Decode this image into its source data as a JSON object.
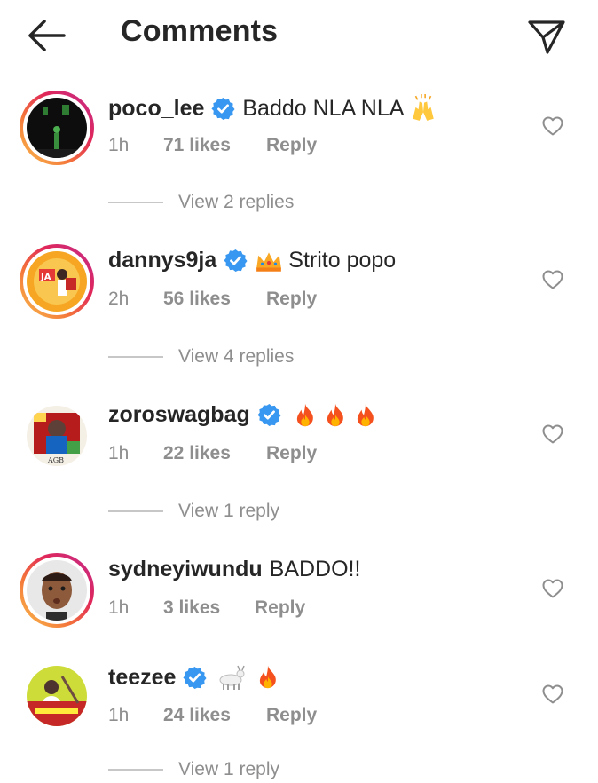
{
  "header": {
    "title": "Comments",
    "back_icon": "arrow-left-icon",
    "share_icon": "send-icon"
  },
  "comments": [
    {
      "username": "poco_lee",
      "verified": true,
      "text": "Baddo NLA NLA",
      "emojis": [
        "raising-hands"
      ],
      "time": "1h",
      "likes": "71 likes",
      "reply": "Reply",
      "view_replies": "View 2 replies"
    },
    {
      "username": "dannys9ja",
      "verified": true,
      "text": "Strito popo",
      "emojis_before": [
        "crown"
      ],
      "time": "2h",
      "likes": "56 likes",
      "reply": "Reply",
      "view_replies": "View 4 replies"
    },
    {
      "username": "zoroswagbag",
      "verified": true,
      "text": "",
      "emojis": [
        "fire",
        "fire",
        "fire"
      ],
      "time": "1h",
      "likes": "22 likes",
      "reply": "Reply",
      "view_replies": "View 1 reply"
    },
    {
      "username": "sydneyiwundu",
      "verified": false,
      "text": "BADDO!!",
      "time": "1h",
      "likes": "3 likes",
      "reply": "Reply"
    },
    {
      "username": "teezee",
      "verified": true,
      "text": "",
      "emojis": [
        "goat",
        "fire"
      ],
      "time": "1h",
      "likes": "24 likes",
      "reply": "Reply",
      "view_replies": "View 1 reply"
    }
  ],
  "colors": {
    "text": "#262626",
    "muted": "#8e8e8e",
    "verified": "#3897f0",
    "divider": "#c7c7c7"
  }
}
